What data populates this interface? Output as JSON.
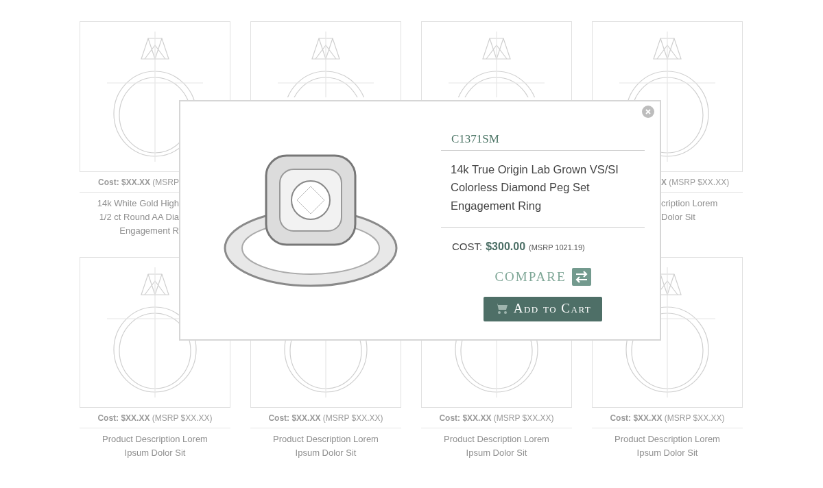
{
  "products": [
    {
      "kind": "clipped-right",
      "cost": "**Cost: $XX.XX** (MSRP",
      "description": [
        "14k White Gold High",
        "1/2 ct Round AA Dia",
        "Engagement R"
      ]
    },
    {
      "kind": "covered"
    },
    {
      "kind": "covered"
    },
    {
      "kind": "clipped-left",
      "cost": "**X** (MSRP $XX.XX)",
      "description": [
        "cription Lorem",
        "Dolor Sit"
      ]
    },
    {
      "kind": "full",
      "cost": "**Cost: $XX.XX** (MSRP $XX.XX)",
      "description": [
        "Product Description Lorem",
        "Ipsum Dolor Sit"
      ]
    },
    {
      "kind": "full",
      "cost": "**Cost: $XX.XX** (MSRP $XX.XX)",
      "description": [
        "Product Description Lorem",
        "Ipsum Dolor Sit"
      ]
    },
    {
      "kind": "full",
      "cost": "**Cost: $XX.XX** (MSRP $XX.XX)",
      "description": [
        "Product Description Lorem",
        "Ipsum Dolor Sit"
      ]
    },
    {
      "kind": "full",
      "cost": "**Cost: $XX.XX** (MSRP $XX.XX)",
      "description": [
        "Product Description Lorem",
        "Ipsum Dolor Sit"
      ]
    }
  ],
  "modal": {
    "sku": "C1371SM",
    "title": "14k True Origin Lab Grown VS/SI Colorless Diamond Peg Set Engagement Ring",
    "cost_label": "COST:",
    "price": "$300.00",
    "msrp": "(MSRP 1021.19)",
    "compare": "COMPARE",
    "add_to_cart": "Add to Cart"
  }
}
